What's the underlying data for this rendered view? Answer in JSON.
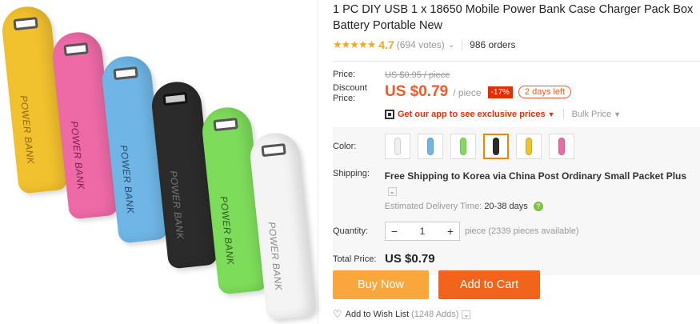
{
  "product": {
    "title": "1 PC DIY USB 1 x 18650 Mobile Power Bank Case Charger Pack Box Battery Portable New",
    "image_text": "POWER BANK",
    "rating_value": "4.7",
    "votes": "(694 votes)",
    "orders": "986 orders"
  },
  "price": {
    "price_label": "Price:",
    "old_price": "US $0.95 / piece",
    "discount_label_1": "Discount",
    "discount_label_2": "Price:",
    "current_price": "US $0.79",
    "per_piece": "/ piece",
    "discount_badge": "-17%",
    "days_left": "2 days left",
    "app_link": "Get our app to see exclusive prices",
    "bulk_price": "Bulk Price"
  },
  "options": {
    "color_label": "Color:",
    "colors": [
      {
        "name": "white",
        "hex": "#f0f0f0"
      },
      {
        "name": "blue",
        "hex": "#6fb6e6"
      },
      {
        "name": "green",
        "hex": "#7ddc5a"
      },
      {
        "name": "black",
        "hex": "#2b2b2b",
        "selected": true
      },
      {
        "name": "yellow",
        "hex": "#f2c12e"
      },
      {
        "name": "pink",
        "hex": "#ee6aa7"
      }
    ],
    "shipping_label": "Shipping:",
    "shipping_main": "Free Shipping to Korea via China Post Ordinary Small Packet Plus",
    "delivery_label": "Estimated Delivery Time:",
    "delivery_time": "20-38",
    "delivery_unit": "days",
    "quantity_label": "Quantity:",
    "quantity_value": "1",
    "minus": "−",
    "plus": "+",
    "availability": "piece (2339 pieces available)",
    "total_label": "Total Price:",
    "total_value": "US $0.79"
  },
  "actions": {
    "buy_now": "Buy Now",
    "add_to_cart": "Add to Cart",
    "wish_label": "Add to Wish List",
    "wish_count": "(1248 Adds)"
  }
}
